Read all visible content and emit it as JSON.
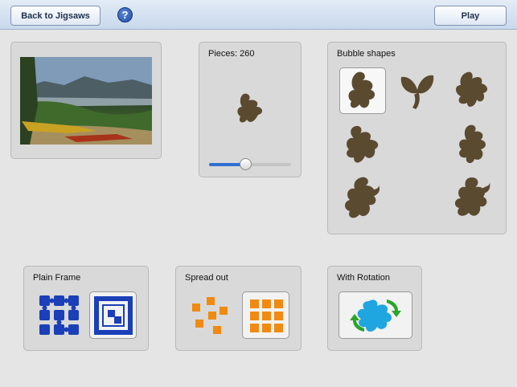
{
  "toolbar": {
    "back_label": "Back to Jigsaws",
    "help_glyph": "?",
    "play_label": "Play"
  },
  "pieces": {
    "label": "Pieces: 260",
    "slider_fraction": 0.45
  },
  "bubble": {
    "title": "Bubble shapes",
    "selected_index": 0
  },
  "frame": {
    "title": "Plain Frame"
  },
  "spread": {
    "title": "Spread out"
  },
  "rotation": {
    "title": "With Rotation"
  },
  "colors": {
    "accent": "#2e6fd1",
    "frame_blue": "#1a3fb8",
    "spread_orange": "#f08a12",
    "rot_green": "#2aa52a",
    "rot_cyan": "#1fa6e0"
  }
}
